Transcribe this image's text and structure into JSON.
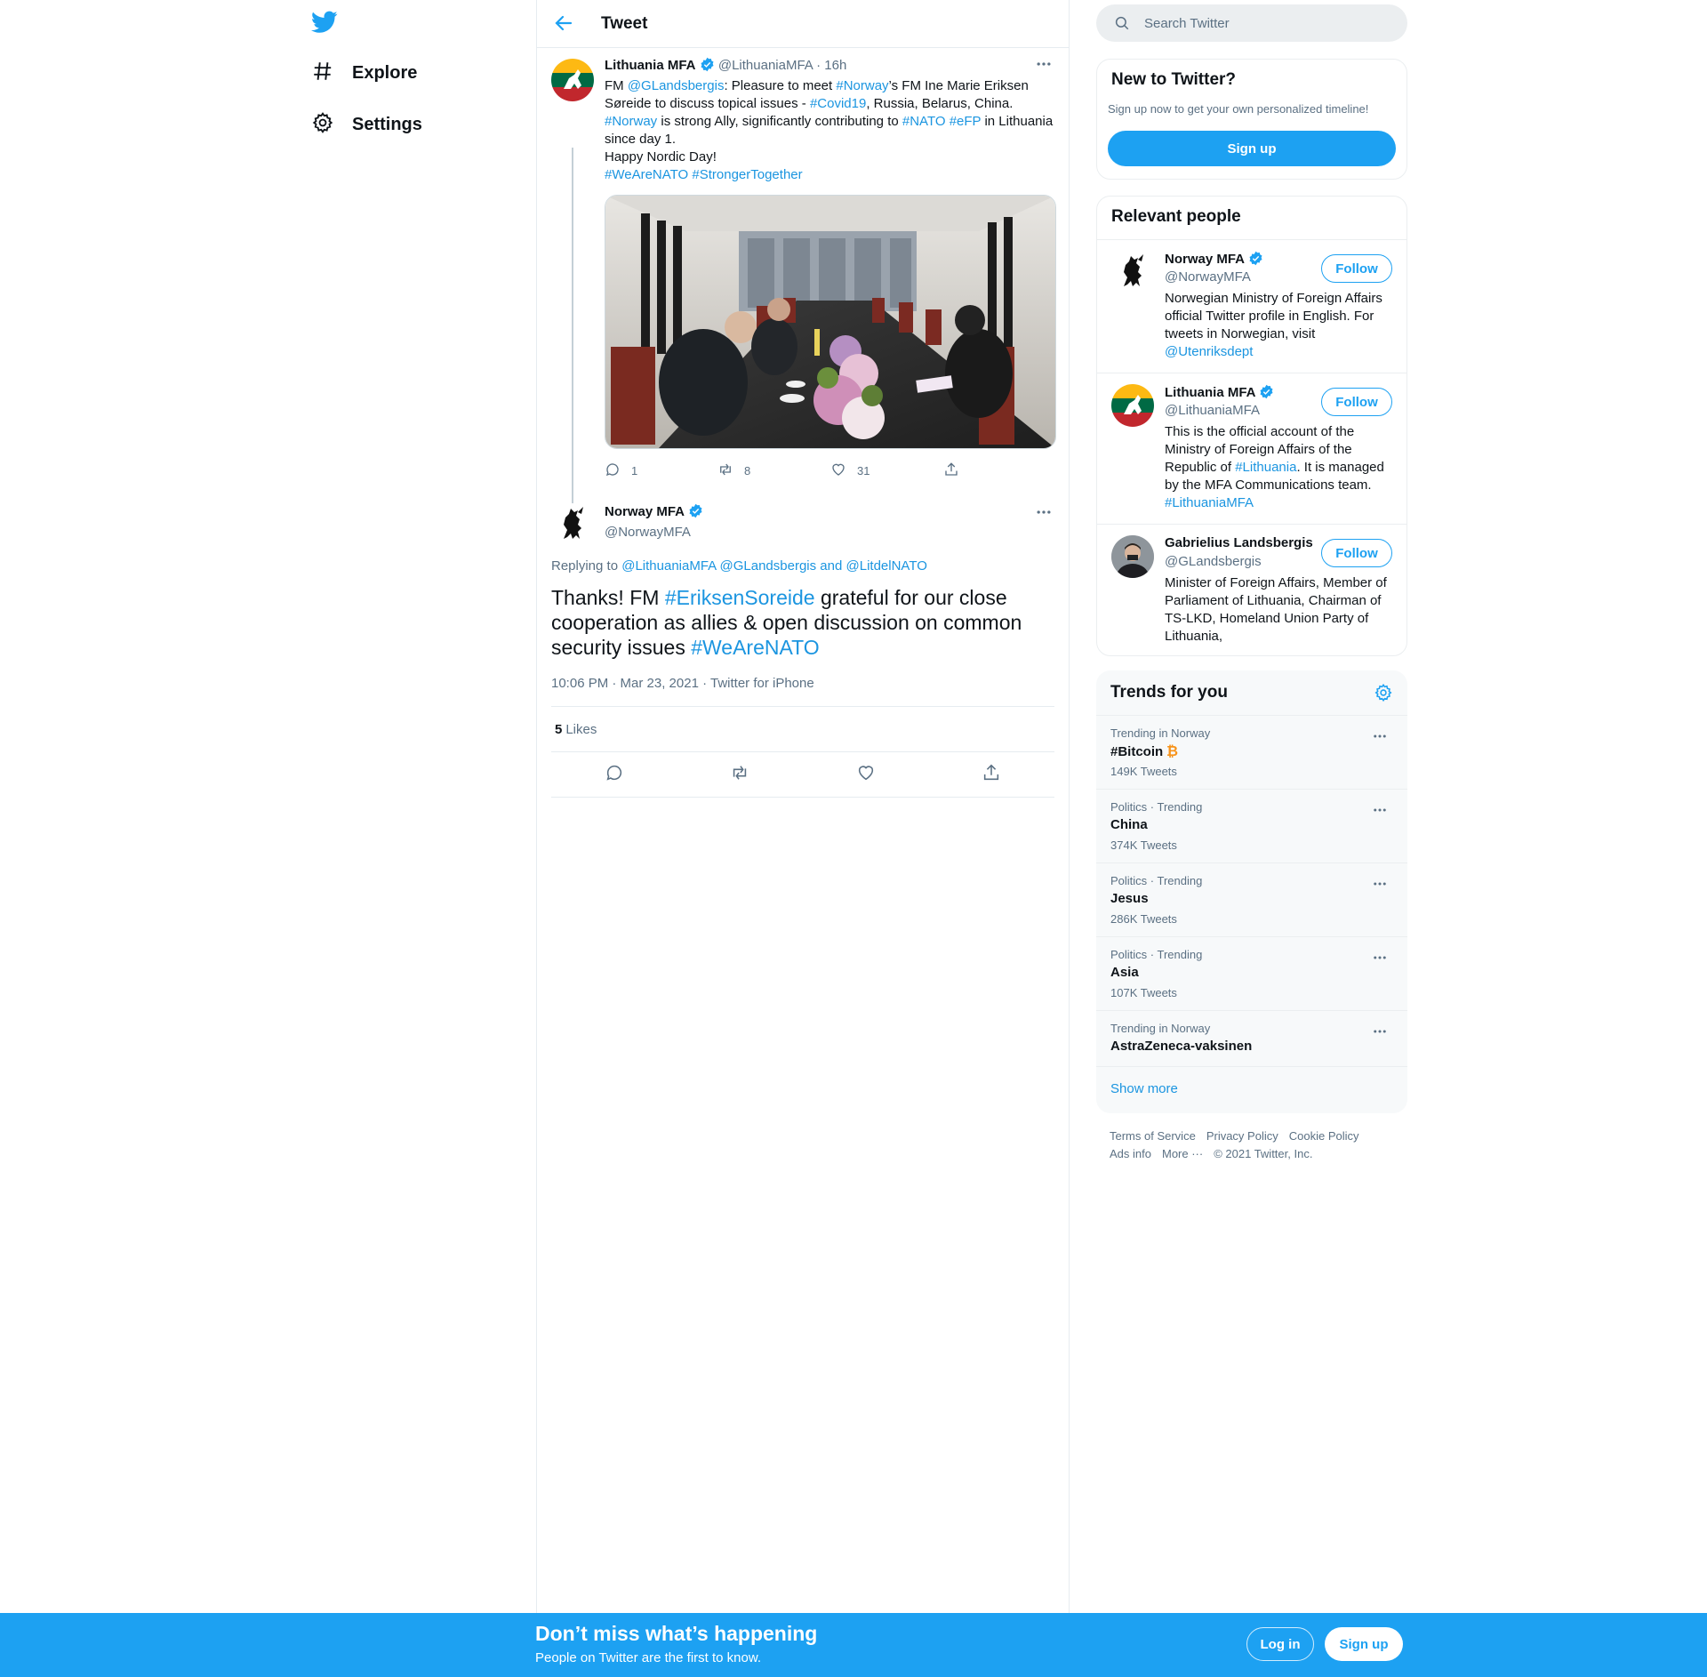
{
  "nav": {
    "logo": "twitter-bird",
    "items": [
      {
        "label": "Explore",
        "icon": "hashtag-icon"
      },
      {
        "label": "Settings",
        "icon": "gear-icon"
      }
    ]
  },
  "header": {
    "title": "Tweet"
  },
  "tweet1": {
    "name": "Lithuania MFA",
    "handle": "@LithuaniaMFA",
    "time": "· 16h",
    "text": {
      "p1": "FM ",
      "m1": "@GLandsbergis",
      "p2": ": Pleasure to meet ",
      "h1": "#Norway",
      "p3": "’s FM Ine Marie Eriksen Søreide to discuss topical issues - ",
      "h2": "#Covid19",
      "p4": ", Russia, Belarus, China.",
      "h3": "#Norway",
      "p5": " is strong Ally, significantly contributing to ",
      "h4": "#NATO",
      "h5": "#eFP",
      "p6": " in Lithuania since day 1.",
      "p7": "Happy Nordic Day!",
      "h6": "#WeAreNATO",
      "h7": "#StrongerTogether"
    },
    "replies": "1",
    "retweets": "8",
    "likes": "31"
  },
  "tweet2": {
    "name": "Norway MFA",
    "handle": "@NorwayMFA",
    "replying_label": "Replying to ",
    "reply_m1": "@LithuaniaMFA",
    "reply_m2": "@GLandsbergis",
    "reply_and": " and ",
    "reply_m3": "@LitdelNATO",
    "text": {
      "p1": "Thanks! FM ",
      "h1": "#EriksenSoreide",
      "p2": " grateful for our close cooperation as allies & open discussion on common security issues ",
      "h2": "#WeAreNATO"
    },
    "timestamp": "10:06 PM · Mar 23, 2021 · Twitter for iPhone",
    "likes_count": "5",
    "likes_label": "Likes"
  },
  "search": {
    "placeholder": "Search Twitter"
  },
  "new_to_twitter": {
    "title": "New to Twitter?",
    "subtitle": "Sign up now to get your own personalized timeline!",
    "button": "Sign up"
  },
  "relevant_people": {
    "title": "Relevant people",
    "people": [
      {
        "name": "Norway MFA",
        "handle": "@NorwayMFA",
        "bio_p1": "Norwegian Ministry of Foreign Affairs official Twitter profile in English. For tweets in Norwegian, visit ",
        "bio_m1": "@Utenriksdept",
        "follow": "Follow"
      },
      {
        "name": "Lithuania MFA",
        "handle": "@LithuaniaMFA",
        "bio_p1": "This is the official account of the Ministry of Foreign Affairs of the Republic of ",
        "bio_h1": "#Lithuania",
        "bio_p2": ". It is managed by the MFA Communications team. ",
        "bio_h2": "#LithuaniaMFA",
        "follow": "Follow"
      },
      {
        "name": "Gabrielius Landsbergis",
        "handle": "@GLandsbergis",
        "bio_p1": "Minister of Foreign Affairs, Member of Parliament of Lithuania, Chairman of TS-LKD, Homeland Union Party of Lithuania,",
        "follow": "Follow"
      }
    ]
  },
  "trends": {
    "title": "Trends for you",
    "items": [
      {
        "context": "Trending in Norway",
        "name": "#Bitcoin",
        "count": "149K Tweets"
      },
      {
        "context": "Politics · Trending",
        "name": "China",
        "count": "374K Tweets"
      },
      {
        "context": "Politics · Trending",
        "name": "Jesus",
        "count": "286K Tweets"
      },
      {
        "context": "Politics · Trending",
        "name": "Asia",
        "count": "107K Tweets"
      },
      {
        "context": "Trending in Norway",
        "name": "AstraZeneca-vaksinen",
        "count": ""
      }
    ],
    "show_more": "Show more"
  },
  "footer": {
    "links": [
      "Terms of Service",
      "Privacy Policy",
      "Cookie Policy",
      "Ads info",
      "More ···",
      "© 2021 Twitter, Inc."
    ]
  },
  "bottom_bar": {
    "title": "Don’t miss what’s happening",
    "subtitle": "People on Twitter are the first to know.",
    "login": "Log in",
    "signup": "Sign up"
  },
  "colors": {
    "brand": "#1da1f2",
    "link": "#1b95e0",
    "muted": "#5b7083"
  }
}
